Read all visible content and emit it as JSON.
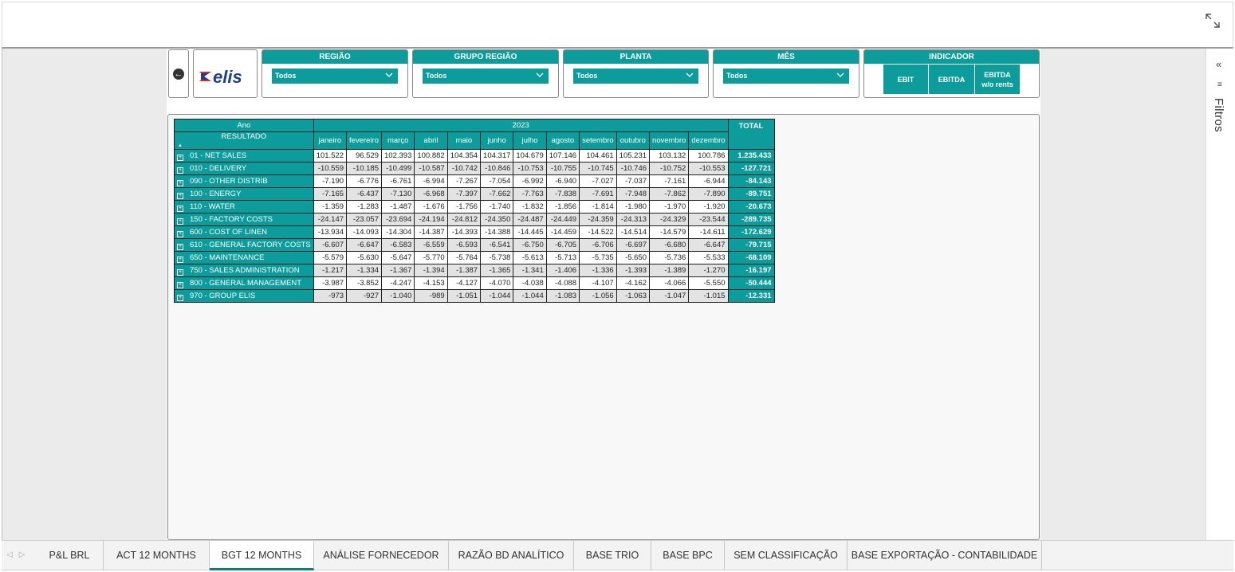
{
  "filters_pane": {
    "label": "Filtros"
  },
  "logo": {
    "text": "elis"
  },
  "slicers": [
    {
      "header": "REGIÃO",
      "value": "Todos"
    },
    {
      "header": "GRUPO REGIÃO",
      "value": "Todos"
    },
    {
      "header": "PLANTA",
      "value": "Todos"
    },
    {
      "header": "MÊS",
      "value": "Todos"
    }
  ],
  "indicator": {
    "header": "INDICADOR",
    "buttons": [
      "EBIT",
      "EBITDA",
      "EBITDA",
      "w/o rents"
    ]
  },
  "table": {
    "ano_label": "Ano",
    "year": "2023",
    "resultado_label": "RESULTADO",
    "total_label": "TOTAL",
    "sort_icon": "▲",
    "months": [
      "janeiro",
      "fevereiro",
      "março",
      "abril",
      "maio",
      "junho",
      "julho",
      "agosto",
      "setembro",
      "outubro",
      "novembro",
      "dezembro"
    ],
    "rows": [
      {
        "label": "01 - NET SALES",
        "values": [
          "101.522",
          "96.529",
          "102.393",
          "100.882",
          "104.354",
          "104.317",
          "104.679",
          "107.146",
          "104.461",
          "105.231",
          "103.132",
          "100.786"
        ],
        "total": "1.235.433"
      },
      {
        "label": "010 - DELIVERY",
        "values": [
          "-10.559",
          "-10.185",
          "-10.499",
          "-10.587",
          "-10.742",
          "-10.846",
          "-10.753",
          "-10.755",
          "-10.745",
          "-10.746",
          "-10.752",
          "-10.553"
        ],
        "total": "-127.721"
      },
      {
        "label": "090 - OTHER DISTRIB",
        "values": [
          "-7.190",
          "-6.776",
          "-6.761",
          "-6.994",
          "-7.267",
          "-7.054",
          "-6.992",
          "-6.940",
          "-7.027",
          "-7.037",
          "-7.161",
          "-6.944"
        ],
        "total": "-84.143"
      },
      {
        "label": "100 - ENERGY",
        "values": [
          "-7.165",
          "-6.437",
          "-7.130",
          "-6.968",
          "-7.397",
          "-7.662",
          "-7.763",
          "-7.838",
          "-7.691",
          "-7.948",
          "-7.862",
          "-7.890"
        ],
        "total": "-89.751"
      },
      {
        "label": "110 - WATER",
        "values": [
          "-1.359",
          "-1.283",
          "-1.487",
          "-1.676",
          "-1.756",
          "-1.740",
          "-1.832",
          "-1.856",
          "-1.814",
          "-1.980",
          "-1.970",
          "-1.920"
        ],
        "total": "-20.673"
      },
      {
        "label": "150 - FACTORY COSTS",
        "values": [
          "-24.147",
          "-23.057",
          "-23.694",
          "-24.194",
          "-24.812",
          "-24.350",
          "-24.487",
          "-24.449",
          "-24.359",
          "-24.313",
          "-24.329",
          "-23.544"
        ],
        "total": "-289.735"
      },
      {
        "label": "600 - COST OF LINEN",
        "values": [
          "-13.934",
          "-14.093",
          "-14.304",
          "-14.387",
          "-14.393",
          "-14.388",
          "-14.445",
          "-14.459",
          "-14.522",
          "-14.514",
          "-14.579",
          "-14.611"
        ],
        "total": "-172.629"
      },
      {
        "label": "610 - GENERAL FACTORY COSTS",
        "values": [
          "-6.607",
          "-6.647",
          "-6.583",
          "-6.559",
          "-6.593",
          "-6.541",
          "-6.750",
          "-6.705",
          "-6.706",
          "-6.697",
          "-6.680",
          "-6.647"
        ],
        "total": "-79.715"
      },
      {
        "label": "650 - MAINTENANCE",
        "values": [
          "-5.579",
          "-5.630",
          "-5.647",
          "-5.770",
          "-5.764",
          "-5.738",
          "-5.613",
          "-5.713",
          "-5.735",
          "-5.650",
          "-5.736",
          "-5.533"
        ],
        "total": "-68.109"
      },
      {
        "label": "750 - SALES ADMINISTRATION",
        "values": [
          "-1.217",
          "-1.334",
          "-1.367",
          "-1.394",
          "-1.387",
          "-1.365",
          "-1.341",
          "-1.406",
          "-1.336",
          "-1.393",
          "-1.389",
          "-1.270"
        ],
        "total": "-16.197"
      },
      {
        "label": "800 - GENERAL MANAGEMENT",
        "values": [
          "-3.987",
          "-3.852",
          "-4.247",
          "-4.153",
          "-4.127",
          "-4.070",
          "-4.038",
          "-4.088",
          "-4.107",
          "-4.162",
          "-4.066",
          "-5.550"
        ],
        "total": "-50.444"
      },
      {
        "label": "970 - GROUP ELIS",
        "values": [
          "-973",
          "-927",
          "-1.040",
          "-989",
          "-1.051",
          "-1.044",
          "-1.044",
          "-1.083",
          "-1.056",
          "-1.063",
          "-1.047",
          "-1.015"
        ],
        "total": "-12.331"
      }
    ]
  },
  "tabs": [
    {
      "label": "P&L BRL",
      "active": false
    },
    {
      "label": "ACT 12 MONTHS",
      "active": false
    },
    {
      "label": "BGT 12 MONTHS",
      "active": true
    },
    {
      "label": "ANÁLISE FORNECEDOR",
      "active": false
    },
    {
      "label": "RAZÃO BD ANALÍTICO",
      "active": false
    },
    {
      "label": "BASE TRIO",
      "active": false
    },
    {
      "label": "BASE BPC",
      "active": false
    },
    {
      "label": "SEM CLASSIFICAÇÃO",
      "active": false
    },
    {
      "label": "BASE EXPORTAÇÃO - CONTABILIDADE",
      "active": false
    }
  ],
  "colors": {
    "accent": "#0d9c9c",
    "active_tab_underline": "#0d7c7c",
    "logo_red": "#d7262e",
    "logo_blue": "#1f3f8f"
  }
}
